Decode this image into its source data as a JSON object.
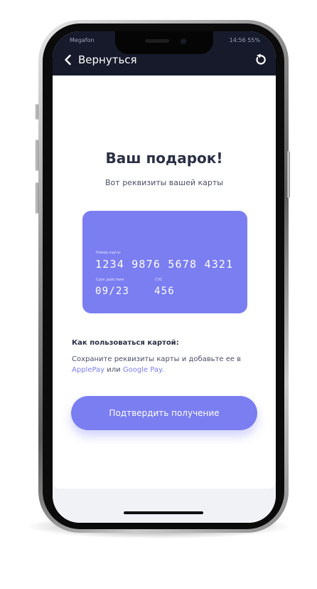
{
  "status": {
    "left": "Megafon",
    "right": "14:56 55%"
  },
  "nav": {
    "back_label": "Вернуться"
  },
  "gift": {
    "title": "Ваш подарок!",
    "subtitle": "Вот реквизиты вашей карты"
  },
  "card": {
    "number_label": "Номер карты",
    "number": "1234 9876 5678 4321",
    "expiry_label": "Срок действия",
    "expiry": "09/23",
    "cvc_label": "CVC",
    "cvc": "456",
    "color": "#7b7ef0"
  },
  "howto": {
    "title": "Как пользоваться картой:",
    "text_before": "Сохраните реквизиты карты и добавьте ее в",
    "applepay": "ApplePay",
    "or": "или",
    "googlepay": "Google Pay",
    "period": "."
  },
  "confirm": {
    "label": "Подтвердить получение"
  },
  "theme": {
    "accent": "#7b7ef0",
    "topbar": "#171a2b",
    "title_text": "#2a2f45"
  },
  "icons": {
    "back": "chevron-left-icon",
    "refresh": "refresh-icon"
  }
}
